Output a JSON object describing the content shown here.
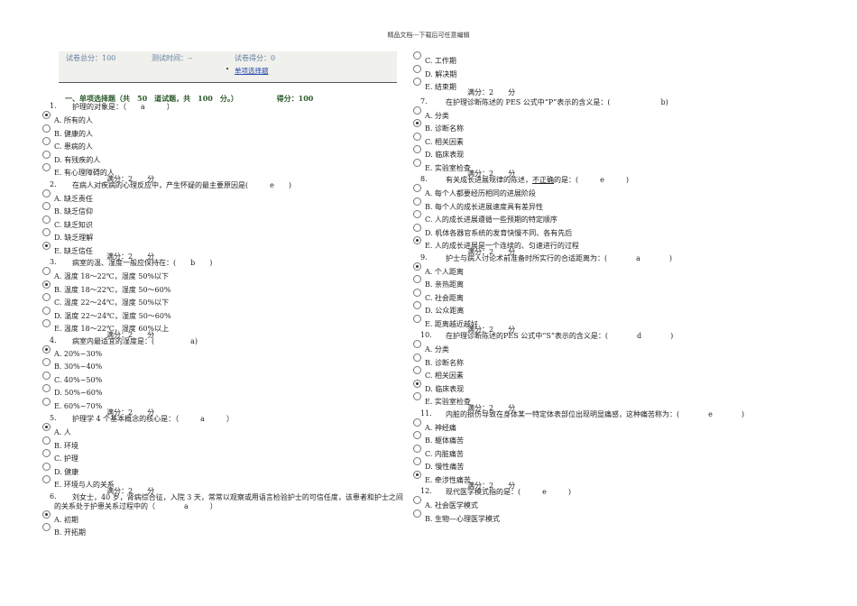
{
  "header": "精品文档---下载后可任意编辑",
  "stats": {
    "total": "试卷总分：100",
    "time": "测试时间：--",
    "got": "试卷得分：0",
    "link": "单项选择题",
    "bullet": "•"
  },
  "section": {
    "title": "一、单项选择题（共　50　道试题，共　100　分。）",
    "score": "得分：100"
  },
  "score_label": "满分：2　　分",
  "left_questions": [
    {
      "n": "1.",
      "text": "护理的对象是：（　　a　　　）",
      "options": [
        {
          "t": "A.  所有的人",
          "sel": true
        },
        {
          "t": "B.  健康的人",
          "sel": false
        },
        {
          "t": "C.  患病的人",
          "sel": false
        },
        {
          "t": "D.  有残疾的人",
          "sel": false
        },
        {
          "t": "E.  有心理障碍的人",
          "sel": false
        }
      ]
    },
    {
      "n": "2.",
      "text": "在病人对疾病的心理反应中，产生怀疑的最主要原因是(　　　e　　)",
      "options": [
        {
          "t": "A.  缺乏责任",
          "sel": false
        },
        {
          "t": "B.  缺乏信仰",
          "sel": false
        },
        {
          "t": "C.  缺乏知识",
          "sel": false
        },
        {
          "t": "D.  缺乏理解",
          "sel": false
        },
        {
          "t": "E.  缺乏信任",
          "sel": true
        }
      ]
    },
    {
      "n": "3.",
      "text": "病室的温、湿度一般应保持在：(　　b　　)",
      "options": [
        {
          "t": "A.  温度 18～22℃，湿度 50%以下",
          "sel": false
        },
        {
          "t": "B.  温度 18～22℃，湿度 50～60%",
          "sel": true
        },
        {
          "t": "C.  温度 22～24℃，湿度 50%以下",
          "sel": false
        },
        {
          "t": "D.  温度 22～24℃，湿度 50～60%",
          "sel": false
        },
        {
          "t": "E.  温度 18～22℃，湿度 60%以上",
          "sel": false
        }
      ]
    },
    {
      "n": "4.",
      "text": "病室内最适宜的湿度是：(　　　　　a)",
      "options": [
        {
          "t": "A.  20%~30%",
          "sel": true
        },
        {
          "t": "B.  30%~40%",
          "sel": false
        },
        {
          "t": "C.  40%~50%",
          "sel": false
        },
        {
          "t": "D.  50%~60%",
          "sel": false
        },
        {
          "t": "E.  60%~70%",
          "sel": false
        }
      ]
    },
    {
      "n": "5.",
      "text": "护理学 4 个基本概念的核心是：（　　　a　　　）",
      "options": [
        {
          "t": "A.  人",
          "sel": true
        },
        {
          "t": "B.  环境",
          "sel": false
        },
        {
          "t": "C.  护理",
          "sel": false
        },
        {
          "t": "D.  健康",
          "sel": false
        },
        {
          "t": "E.  环境与人的关系",
          "sel": false
        }
      ]
    },
    {
      "n": "6.",
      "text": "刘女士，40 岁，肾病综合征，入院 3 天，常常以观察或用语言检验护士的可信任度，该患者和护士之间",
      "text2": "的关系处于护患关系过程中的（　　　　a　　　）",
      "options": [
        {
          "t": "A.  初期",
          "sel": true
        },
        {
          "t": "B.  开拓期",
          "sel": false
        }
      ]
    }
  ],
  "right_top_options": [
    {
      "t": "C.  工作期",
      "sel": false
    },
    {
      "t": "D.  解决期",
      "sel": false
    },
    {
      "t": "E.  结束期",
      "sel": false
    }
  ],
  "right_questions": [
    {
      "n": "7.",
      "text": "在护理诊断陈述的 PES 公式中“P”表示的含义是：(　　　　　　　b)",
      "options": [
        {
          "t": "A.  分类",
          "sel": false
        },
        {
          "t": "B.  诊断名称",
          "sel": true
        },
        {
          "t": "C.  相关因素",
          "sel": false
        },
        {
          "t": "D.  临床表现",
          "sel": false
        },
        {
          "t": "E.  实验室检查",
          "sel": false
        }
      ]
    },
    {
      "n": "8.",
      "text_a": "有关成长进展规律的陈述，",
      "text_u": "不正确",
      "text_b": "的是：(　　　e　　　)",
      "options": [
        {
          "t": "A.  每个人都要经历相同的进展阶段",
          "sel": false
        },
        {
          "t": "B.  每个人的成长进展速度具有差异性",
          "sel": false
        },
        {
          "t": "C.  人的成长进展遵循一些预期的特定顺序",
          "sel": false
        },
        {
          "t": "D.  机体各器官系统的发育快慢不同、各有先后",
          "sel": false
        },
        {
          "t": "E.  人的成长进展是一个连续的、匀速进行的过程",
          "sel": true
        }
      ]
    },
    {
      "n": "9.",
      "text": "护士与病人讨论术前准备时所实行的合适距离为：(　　　　a　　　　)",
      "options": [
        {
          "t": "A.  个人距离",
          "sel": true
        },
        {
          "t": "B.  亲热距离",
          "sel": false
        },
        {
          "t": "C.  社会距离",
          "sel": false
        },
        {
          "t": "D.  公众距离",
          "sel": false
        },
        {
          "t": "E.  距离越近越好",
          "sel": false
        }
      ]
    },
    {
      "n": "10.",
      "text": "在护理诊断陈述的PES 公式中“S”表示的含义是：(　　　　d　　　　)",
      "options": [
        {
          "t": "A.  分类",
          "sel": false
        },
        {
          "t": "B.  诊断名称",
          "sel": false
        },
        {
          "t": "C.  相关因素",
          "sel": false
        },
        {
          "t": "D.  临床表现",
          "sel": true
        },
        {
          "t": "E.  实验室检查",
          "sel": false
        }
      ]
    },
    {
      "n": "11.",
      "text": "内脏的损伤导致在身体某一特定体表部位出现明显痛感，这种痛苦称为：(　　　　e　　　　)",
      "options": [
        {
          "t": "A.  神经痛",
          "sel": false
        },
        {
          "t": "B.  躯体痛苦",
          "sel": false
        },
        {
          "t": "C.  内脏痛苦",
          "sel": false
        },
        {
          "t": "D.  慢性痛苦",
          "sel": false
        },
        {
          "t": "E.  牵涉性痛苦",
          "sel": true
        }
      ]
    },
    {
      "n": "12.",
      "text": "现代医学模式指的是：(　　　e　　　)",
      "options": [
        {
          "t": "A.  社会医学模式",
          "sel": false
        },
        {
          "t": "B.  生物—心理医学模式",
          "sel": false
        }
      ]
    }
  ]
}
